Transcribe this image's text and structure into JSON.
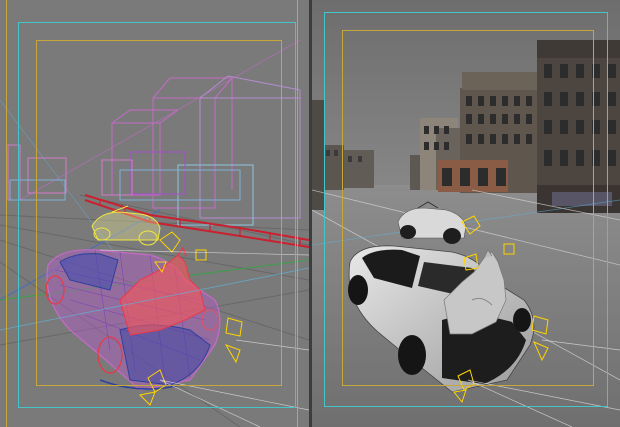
{
  "app": {
    "title": ""
  },
  "viewports": [
    {
      "id": "left",
      "mode": "wireframe",
      "label": ""
    },
    {
      "id": "right",
      "mode": "shaded",
      "label": ""
    }
  ],
  "colors": {
    "safe_action": "#43c5c9",
    "safe_title": "#c8a73a",
    "ground": "#7a7a7a",
    "wire_red": "#c9212f",
    "wire_magenta": "#c56ac7",
    "wire_blue": "#2f3f9b",
    "wire_yellow": "#f0e642",
    "light_icon": "#ffd400",
    "grid_line": "#4d6fb5"
  },
  "icons": [
    "light-icon",
    "camera-frustum-icon"
  ]
}
